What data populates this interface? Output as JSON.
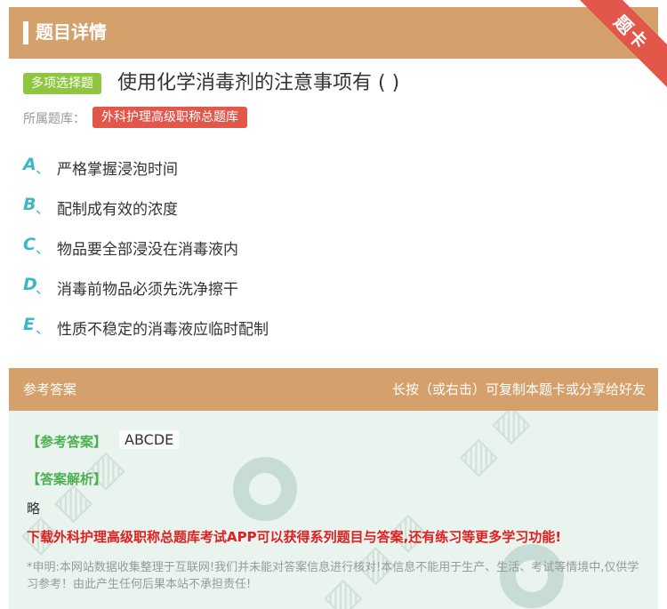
{
  "header": {
    "title": "题目详情",
    "ribbon_label": "题卡"
  },
  "question": {
    "type_badge": "多项选择题",
    "text": "使用化学消毒剂的注意事项有 ( )",
    "bank_label": "所属题库：",
    "bank_name": "外科护理高级职称总题库"
  },
  "options": [
    {
      "letter": "A",
      "sep": "、",
      "text": "严格掌握浸泡时间"
    },
    {
      "letter": "B",
      "sep": "、",
      "text": "配制成有效的浓度"
    },
    {
      "letter": "C",
      "sep": "、",
      "text": "物品要全部浸没在消毒液内"
    },
    {
      "letter": "D",
      "sep": "、",
      "text": "消毒前物品必须先洗净擦干"
    },
    {
      "letter": "E",
      "sep": "、",
      "text": "性质不稳定的消毒液应临时配制"
    }
  ],
  "answer_bar": {
    "left": "参考答案",
    "right": "长按（或右击）可复制本题卡或分享给好友"
  },
  "answer": {
    "label": "【参考答案】",
    "value": "ABCDE",
    "analysis_label": "【答案解析】",
    "analysis_text": "略",
    "promo": "下载外科护理高级职称总题库考试APP可以获得系列题目与答案,还有练习等更多学习功能!",
    "disclaimer": "*申明:本网站数据收集整理于互联网!我们并未能对答案信息进行核对!本信息不能用于生产、生活、考试等情境中,仅供学习参考！由此产生任何后果本站不承担责任!"
  },
  "colors": {
    "header_bg": "#d4a06b",
    "ribbon": "#e3564a",
    "type_badge": "#8ec63f",
    "bank_badge": "#e3564a",
    "option_letter": "#3cb8c4",
    "answer_panel_bg": "#e9f4ef",
    "answer_label": "#4caf50",
    "promo": "#e02020"
  }
}
